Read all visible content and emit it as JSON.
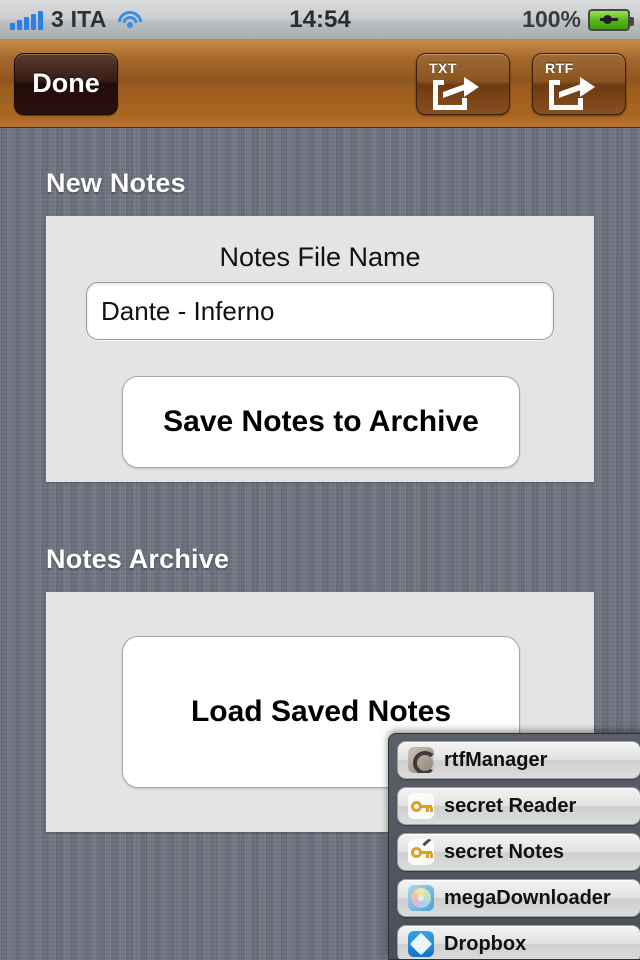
{
  "statusbar": {
    "carrier": "3 ITA",
    "time": "14:54",
    "battery_percent": "100%",
    "signal_icon": "signal-bars-icon",
    "wifi_icon": "wifi-icon",
    "battery_icon": "battery-charging-icon"
  },
  "navbar": {
    "done_label": "Done",
    "txt_label": "TXT",
    "rtf_label": "RTF",
    "txt_icon": "share-export-icon",
    "rtf_icon": "share-export-icon",
    "accent_color": "#8d5520"
  },
  "main": {
    "new_notes": {
      "section_title": "New Notes",
      "field_label": "Notes File Name",
      "file_name_value": "Dante - Inferno",
      "file_name_placeholder": "Notes File Name",
      "save_button_label": "Save Notes to Archive"
    },
    "notes_archive": {
      "section_title": "Notes Archive",
      "load_button_label": "Load Saved Notes"
    }
  },
  "popover": {
    "apps": [
      {
        "label": "rtfManager",
        "icon": "rtfmanager-app-icon"
      },
      {
        "label": "secret Reader",
        "icon": "key-app-icon"
      },
      {
        "label": "secret Notes",
        "icon": "key-pencil-app-icon"
      },
      {
        "label": "megaDownloader",
        "icon": "disc-app-icon"
      },
      {
        "label": "Dropbox",
        "icon": "dropbox-app-icon"
      }
    ]
  }
}
